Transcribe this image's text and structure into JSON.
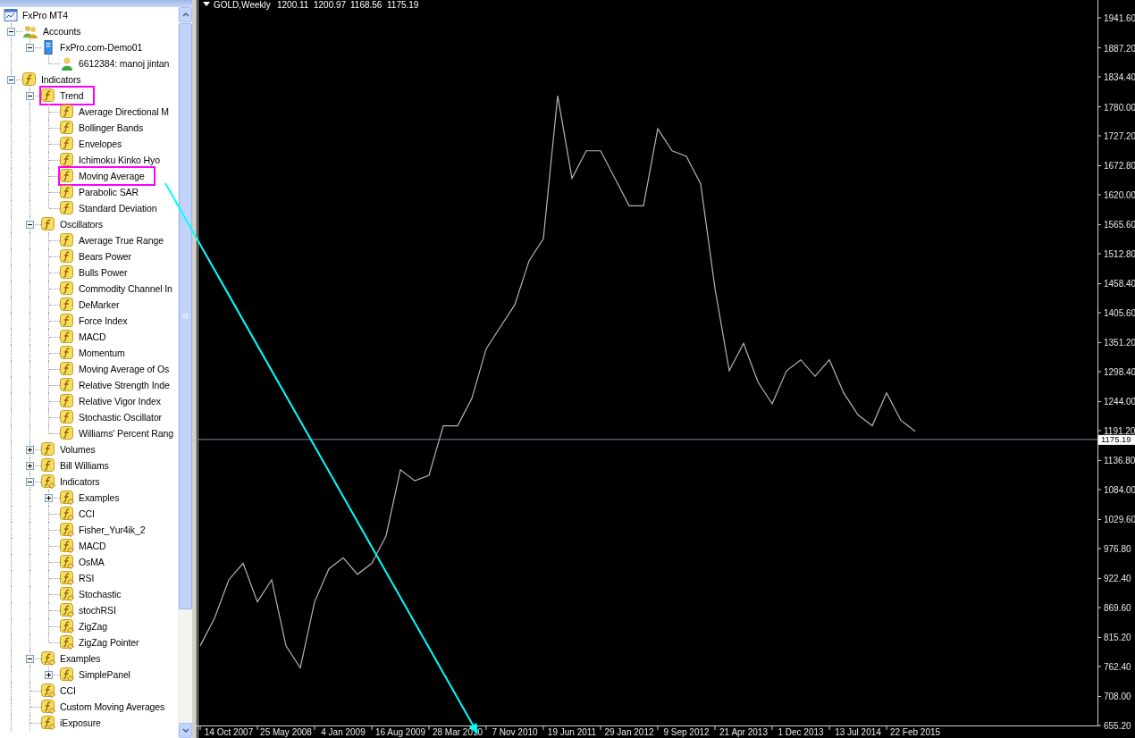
{
  "navigator": {
    "tree": [
      {
        "label": "FxPro MT4",
        "kind": "terminal",
        "children": [
          {
            "label": "Accounts",
            "kind": "accounts",
            "expanded": true,
            "children": [
              {
                "label": "FxPro.com-Demo01",
                "kind": "server",
                "expanded": true,
                "children": [
                  {
                    "label": "6612384: manoj jintan",
                    "kind": "account"
                  }
                ]
              }
            ]
          },
          {
            "label": "Indicators",
            "kind": "indicator",
            "expanded": true,
            "children": [
              {
                "label": "Trend",
                "kind": "indicator",
                "expanded": true,
                "highlighted": true,
                "children": [
                  {
                    "label": "Average Directional M",
                    "kind": "indicator",
                    "highlighted": false
                  },
                  {
                    "label": "Bollinger Bands",
                    "kind": "indicator",
                    "highlighted": false
                  },
                  {
                    "label": "Envelopes",
                    "kind": "indicator",
                    "highlighted": false
                  },
                  {
                    "label": "Ichimoku Kinko Hyo",
                    "kind": "indicator",
                    "highlighted": false
                  },
                  {
                    "label": "Moving Average",
                    "kind": "indicator",
                    "highlighted": true
                  },
                  {
                    "label": "Parabolic SAR",
                    "kind": "indicator",
                    "highlighted": false
                  },
                  {
                    "label": "Standard Deviation",
                    "kind": "indicator",
                    "highlighted": false
                  }
                ]
              },
              {
                "label": "Oscillators",
                "kind": "indicator",
                "expanded": true,
                "highlighted": false,
                "children": [
                  {
                    "label": "Average True Range",
                    "kind": "indicator"
                  },
                  {
                    "label": "Bears Power",
                    "kind": "indicator"
                  },
                  {
                    "label": "Bulls Power",
                    "kind": "indicator"
                  },
                  {
                    "label": "Commodity Channel In",
                    "kind": "indicator"
                  },
                  {
                    "label": "DeMarker",
                    "kind": "indicator"
                  },
                  {
                    "label": "Force Index",
                    "kind": "indicator"
                  },
                  {
                    "label": "MACD",
                    "kind": "indicator"
                  },
                  {
                    "label": "Momentum",
                    "kind": "indicator"
                  },
                  {
                    "label": "Moving Average of Os",
                    "kind": "indicator"
                  },
                  {
                    "label": "Relative Strength Inde",
                    "kind": "indicator"
                  },
                  {
                    "label": "Relative Vigor Index",
                    "kind": "indicator"
                  },
                  {
                    "label": "Stochastic Oscillator",
                    "kind": "indicator"
                  },
                  {
                    "label": "Williams' Percent Rang",
                    "kind": "indicator"
                  }
                ]
              },
              {
                "label": "Volumes",
                "kind": "indicator",
                "expanded": false
              },
              {
                "label": "Bill Williams",
                "kind": "indicator",
                "expanded": false
              },
              {
                "label": "Indicators",
                "kind": "custom",
                "expanded": true,
                "children": [
                  {
                    "label": "Examples",
                    "kind": "custom",
                    "expanded": false
                  },
                  {
                    "label": "CCI",
                    "kind": "custom"
                  },
                  {
                    "label": "Fisher_Yur4ik_2",
                    "kind": "custom"
                  },
                  {
                    "label": "MACD",
                    "kind": "custom"
                  },
                  {
                    "label": "OsMA",
                    "kind": "custom"
                  },
                  {
                    "label": "RSI",
                    "kind": "custom"
                  },
                  {
                    "label": "Stochastic",
                    "kind": "custom"
                  },
                  {
                    "label": "stochRSI",
                    "kind": "custom"
                  },
                  {
                    "label": "ZigZag",
                    "kind": "custom"
                  },
                  {
                    "label": "ZigZag Pointer",
                    "kind": "custom"
                  }
                ]
              },
              {
                "label": "Examples",
                "kind": "custom",
                "expanded": true,
                "children": [
                  {
                    "label": "SimplePanel",
                    "kind": "custom",
                    "expanded": false
                  }
                ]
              },
              {
                "label": "CCI",
                "kind": "custom"
              },
              {
                "label": "Custom Moving Averages",
                "kind": "custom"
              },
              {
                "label": "iExposure",
                "kind": "custom"
              }
            ]
          }
        ]
      }
    ]
  },
  "chart": {
    "symbol": "GOLD,Weekly",
    "ohlc": [
      "1200.11",
      "1200.97",
      "1168.56",
      "1175.19"
    ],
    "chart_data": {
      "type": "line",
      "categories": [
        null,
        null,
        "14 Oct 2007",
        null,
        null,
        null,
        "25 May 2008",
        null,
        null,
        null,
        "4 Jan 2009",
        null,
        null,
        null,
        "16 Aug 2009",
        null,
        null,
        null,
        "28 Mar 2010",
        null,
        null,
        null,
        "7 Nov 2010",
        null,
        null,
        null,
        "19 Jun 2011",
        null,
        null,
        null,
        "29 Jan 2012",
        null,
        null,
        null,
        "9 Sep 2012",
        null,
        null,
        null,
        "21 Apr 2013",
        null,
        null,
        null,
        "1 Dec 2013",
        null,
        null,
        null,
        "13 Jul 2014",
        null,
        null,
        null,
        "22 Feb 2015"
      ],
      "series": [
        {
          "color": "#b4b4b4",
          "values": [
            800,
            850,
            920,
            950,
            880,
            920,
            800,
            760,
            880,
            940,
            960,
            930,
            950,
            1000,
            1120,
            1100,
            1110,
            1200,
            1200,
            1250,
            1340,
            1380,
            1420,
            1500,
            1540,
            1800,
            1650,
            1700,
            1700,
            1650,
            1600,
            1600,
            1740,
            1700,
            1690,
            1640,
            1450,
            1300,
            1350,
            1280,
            1240,
            1300,
            1320,
            1290,
            1320,
            1260,
            1220,
            1200,
            1260,
            1210,
            1190
          ]
        }
      ],
      "ylim": [
        655.2,
        1974.1
      ],
      "yticks": [
        {
          "value": 1941.6,
          "label": "1941.60"
        },
        {
          "value": 1887.2,
          "label": "1887.20"
        },
        {
          "value": 1834.4,
          "label": "1834.40"
        },
        {
          "value": 1780,
          "label": "1780.00"
        },
        {
          "value": 1727.2,
          "label": "1727.20"
        },
        {
          "value": 1672.8,
          "label": "1672.80"
        },
        {
          "value": 1620,
          "label": "1620.00"
        },
        {
          "value": 1565.6,
          "label": "1565.60"
        },
        {
          "value": 1512.8,
          "label": "1512.80"
        },
        {
          "value": 1458.4,
          "label": "1458.40"
        },
        {
          "value": 1405.6,
          "label": "1405.60"
        },
        {
          "value": 1351.2,
          "label": "1351.20"
        },
        {
          "value": 1298.4,
          "label": "1298.40"
        },
        {
          "value": 1244,
          "label": "1244.00"
        },
        {
          "value": 1191.2,
          "label": "1191.20"
        },
        {
          "value": 1136.8,
          "label": "1136.80"
        },
        {
          "value": 1084,
          "label": "1084.00"
        },
        {
          "value": 1029.6,
          "label": "1029.60"
        },
        {
          "value": 976.8,
          "label": "976.80"
        },
        {
          "value": 922.4,
          "label": "922.40"
        },
        {
          "value": 869.6,
          "label": "869.60"
        },
        {
          "value": 815.2,
          "label": "815.20"
        },
        {
          "value": 762.4,
          "label": "762.40"
        },
        {
          "value": 708,
          "label": "708.00"
        },
        {
          "value": 655.2,
          "label": "655.20"
        }
      ],
      "ref_lines": [
        {
          "axis": "y",
          "value": 1175.19,
          "label": "1175.19",
          "color": "#7088a8"
        }
      ]
    }
  }
}
